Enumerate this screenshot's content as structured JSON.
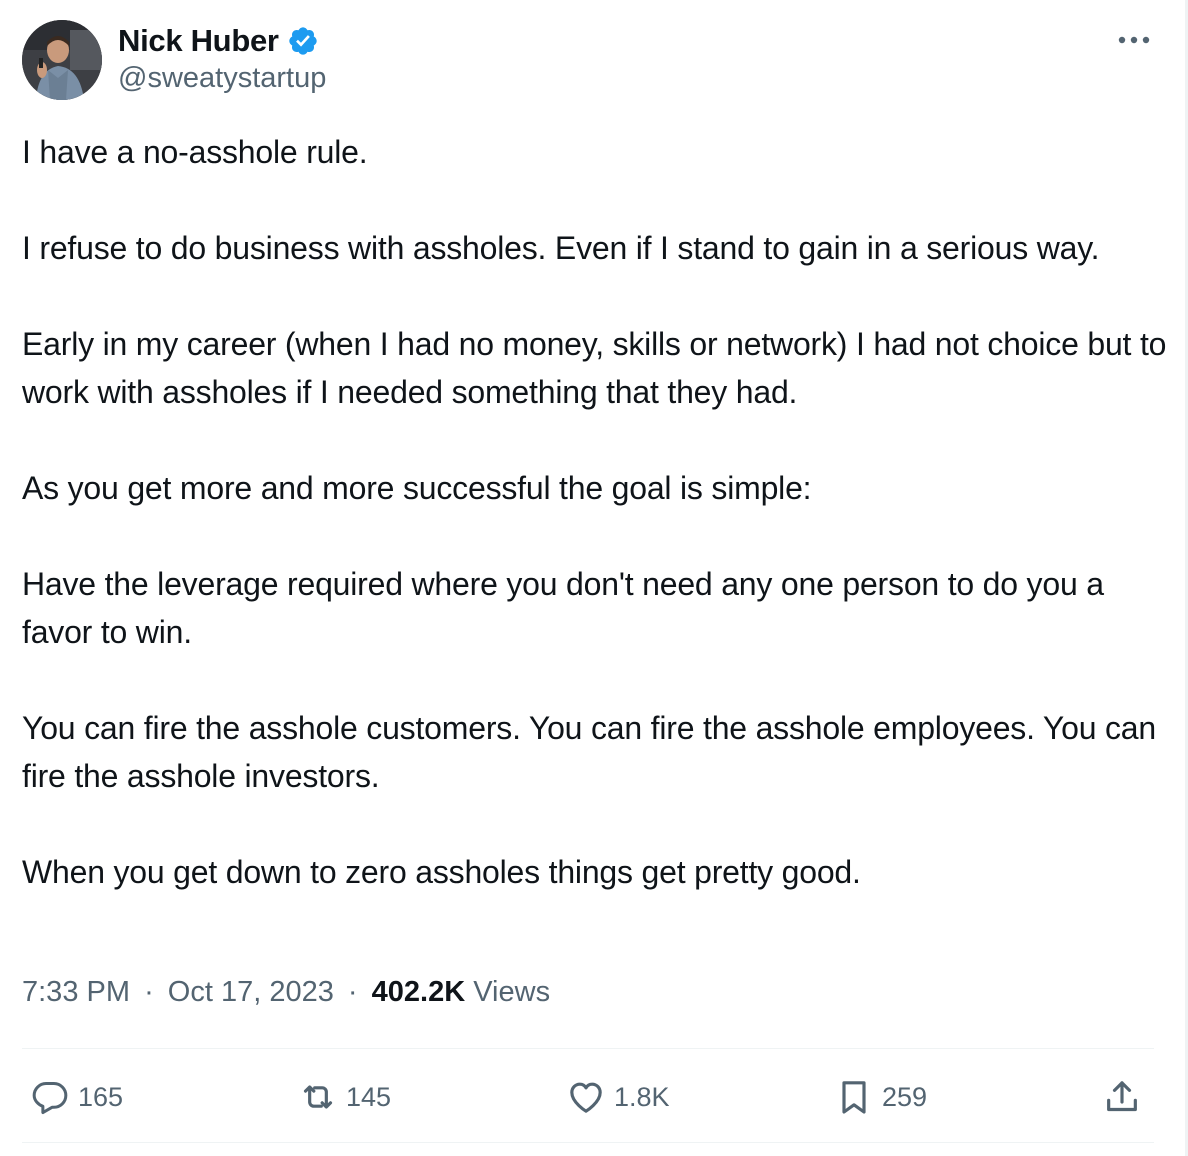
{
  "author": {
    "name": "Nick Huber",
    "handle": "@sweatystartup",
    "verified_color": "#1d9bf0"
  },
  "icons": {
    "avatar": "avatar",
    "verified": "verified-badge-icon",
    "more": "more-options-icon",
    "reply": "reply-icon",
    "repost": "repost-icon",
    "like": "heart-icon",
    "bookmark": "bookmark-icon",
    "share": "share-icon"
  },
  "tweet": {
    "paragraphs": [
      "I have a no-asshole rule.",
      "I refuse to do business with assholes. Even if I stand to gain in a serious way.",
      "Early in my career (when I had no money, skills or network) I had not choice but to work with assholes if I needed something that they had.",
      "As you get more and more successful the goal is simple:",
      "Have the leverage required where you don't need any one person to do you a favor to win.",
      "You can fire the asshole customers. You can fire the asshole employees. You can fire the asshole investors.",
      "When you get down to zero assholes things get pretty good."
    ]
  },
  "meta": {
    "time": "7:33 PM",
    "separator": "·",
    "date": "Oct 17, 2023",
    "views_count": "402.2K",
    "views_label": "Views"
  },
  "actions": {
    "reply_count": "165",
    "repost_count": "145",
    "like_count": "1.8K",
    "bookmark_count": "259"
  },
  "colors": {
    "text_primary": "#0f1419",
    "text_secondary": "#536471",
    "divider": "#eff3f4",
    "verified": "#1d9bf0"
  }
}
